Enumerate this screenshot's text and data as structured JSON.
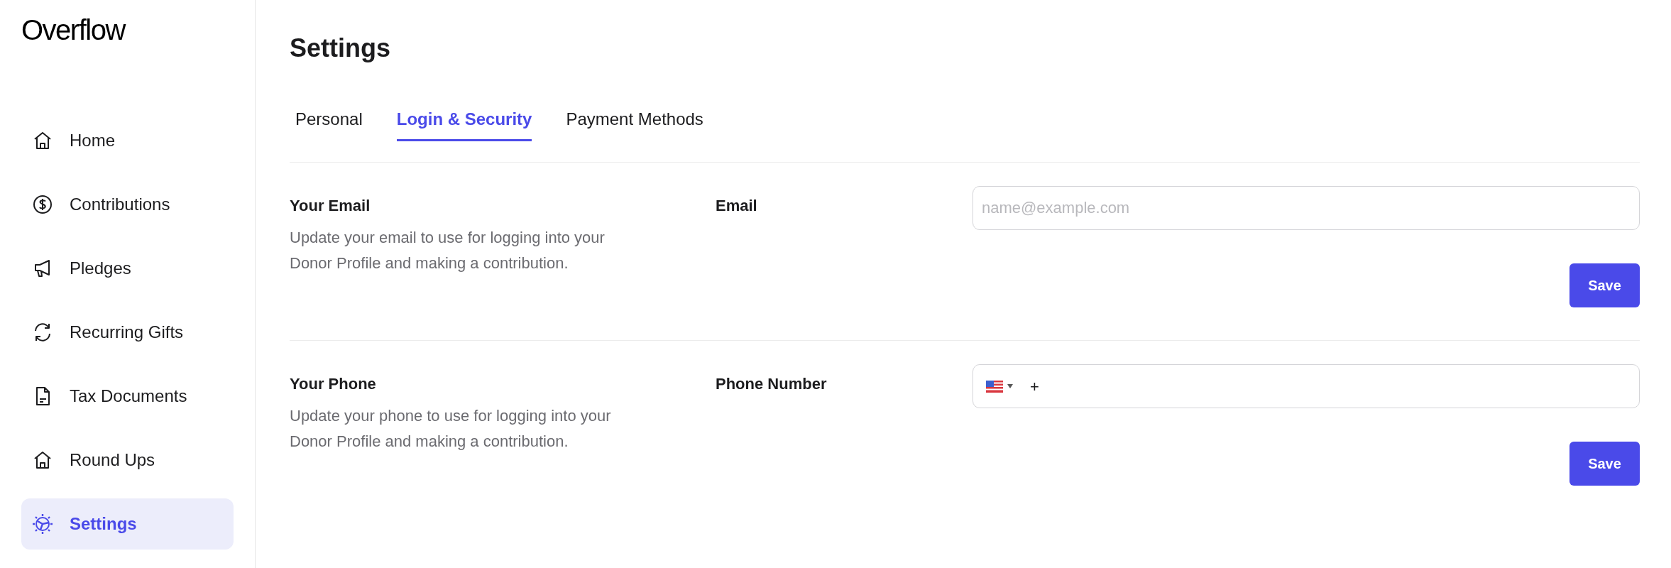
{
  "logo": "Overflow",
  "sidebar": {
    "items": [
      {
        "kind": "home",
        "label": "Home",
        "selected": false
      },
      {
        "kind": "dollar",
        "label": "Contributions",
        "selected": false
      },
      {
        "kind": "megaphone",
        "label": "Pledges",
        "selected": false
      },
      {
        "kind": "refresh",
        "label": "Recurring Gifts",
        "selected": false
      },
      {
        "kind": "document",
        "label": "Tax Documents",
        "selected": false
      },
      {
        "kind": "home",
        "label": "Round Ups",
        "selected": false
      },
      {
        "kind": "gear",
        "label": "Settings",
        "selected": true
      }
    ]
  },
  "page_title": "Settings",
  "tabs": [
    {
      "label": "Personal",
      "selected": false
    },
    {
      "label": "Login & Security",
      "selected": true
    },
    {
      "label": "Payment Methods",
      "selected": false
    }
  ],
  "sections": [
    {
      "kind": "email",
      "title": "Your Email",
      "description": "Update your email to use for logging into your Donor Profile and making a contribution.",
      "field_label": "Email",
      "placeholder": "name@example.com",
      "button": "Save"
    },
    {
      "kind": "phone",
      "title": "Your Phone",
      "description": "Update your phone to use for logging into your Donor Profile and making a contribution.",
      "field_label": "Phone Number",
      "value": "+",
      "button": "Save"
    }
  ]
}
